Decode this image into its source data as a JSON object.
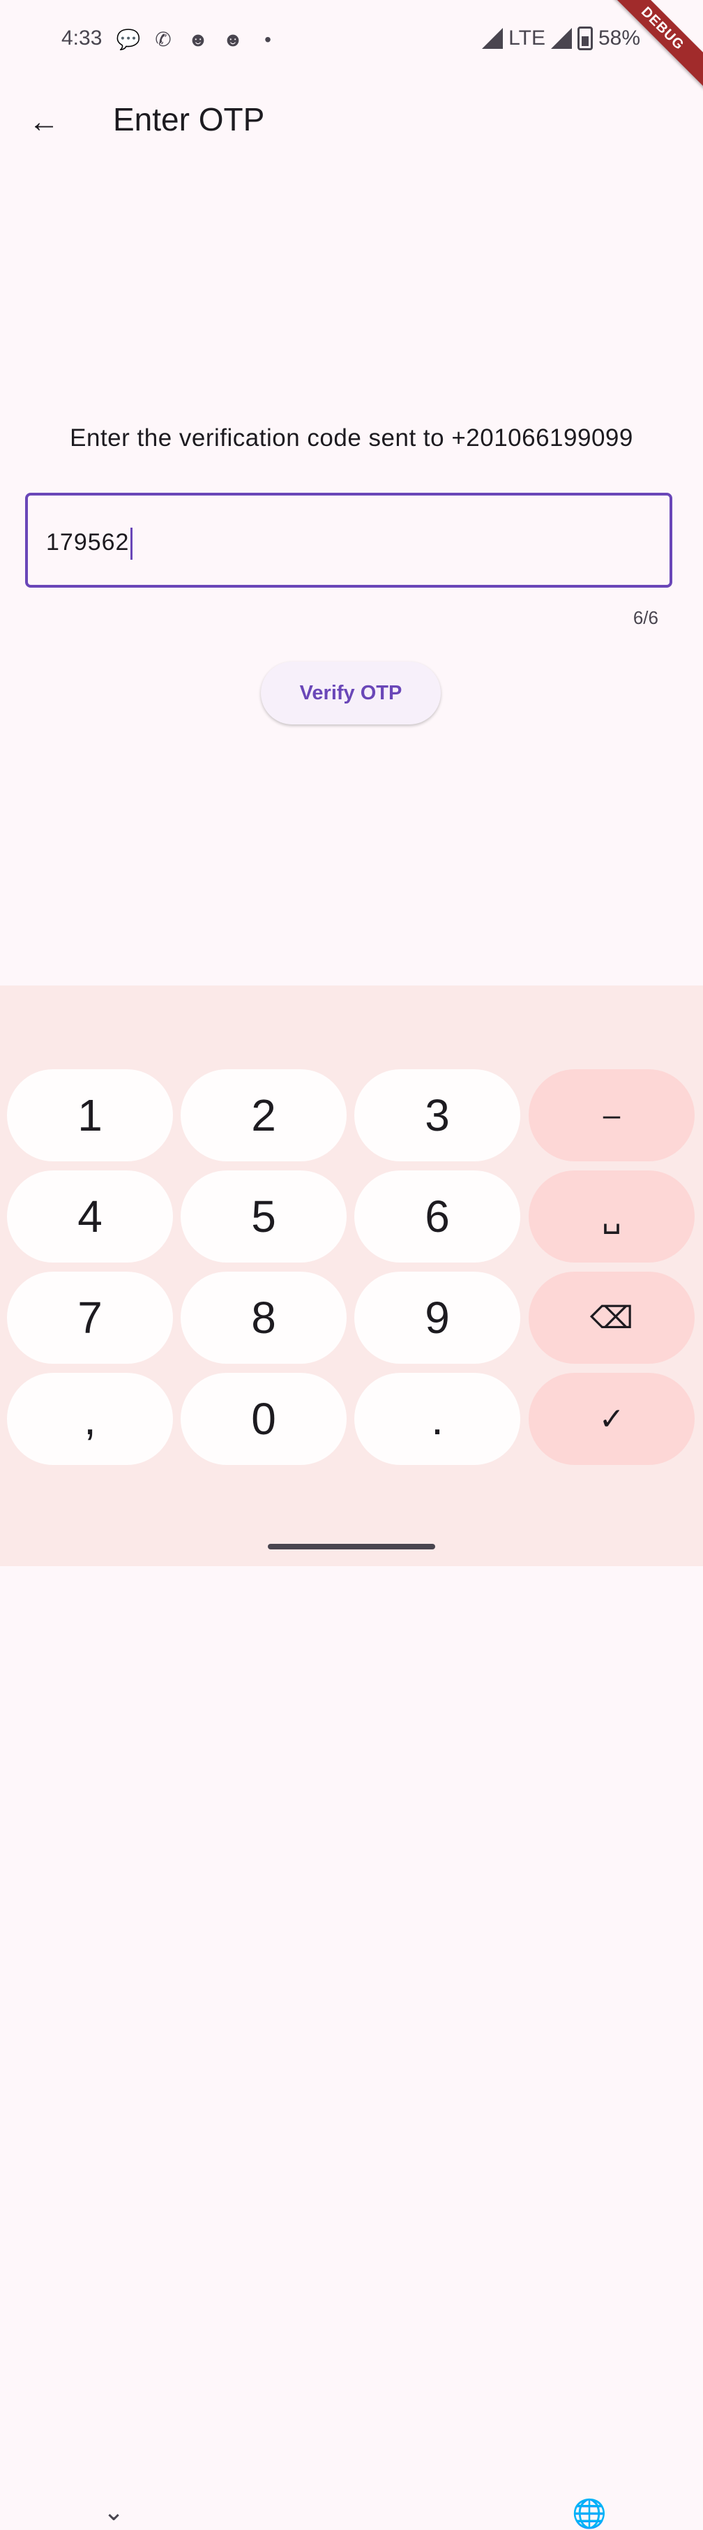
{
  "status_bar": {
    "time": "4:33",
    "network": "LTE",
    "battery": "58%",
    "notification_icons": [
      "chat-icon",
      "whatsapp-icon",
      "discord-icon",
      "discord-icon",
      "dot-icon"
    ]
  },
  "debug_banner": "DEBUG",
  "app_bar": {
    "title": "Enter OTP"
  },
  "instruction": "Enter the verification code sent to +201066199099",
  "otp_field": {
    "value": "179562",
    "counter": "6/6"
  },
  "verify_button": "Verify OTP",
  "keyboard": {
    "keys": [
      {
        "label": "1",
        "name": "key-1"
      },
      {
        "label": "2",
        "name": "key-2"
      },
      {
        "label": "3",
        "name": "key-3"
      },
      {
        "label": "–",
        "name": "key-minus"
      },
      {
        "label": "4",
        "name": "key-4"
      },
      {
        "label": "5",
        "name": "key-5"
      },
      {
        "label": "6",
        "name": "key-6"
      },
      {
        "label": "␣",
        "name": "key-space"
      },
      {
        "label": "7",
        "name": "key-7"
      },
      {
        "label": "8",
        "name": "key-8"
      },
      {
        "label": "9",
        "name": "key-9"
      },
      {
        "label": "⌫",
        "name": "key-backspace"
      },
      {
        "label": ",",
        "name": "key-comma"
      },
      {
        "label": "0",
        "name": "key-0"
      },
      {
        "label": ".",
        "name": "key-period"
      },
      {
        "label": "✓",
        "name": "key-done"
      }
    ]
  },
  "colors": {
    "accent": "#6a47b8",
    "background": "#fef7fa",
    "keyboard_bg": "#fbe9e8",
    "function_key": "#fdd7d6",
    "debug_ribbon": "#a12b2b"
  }
}
